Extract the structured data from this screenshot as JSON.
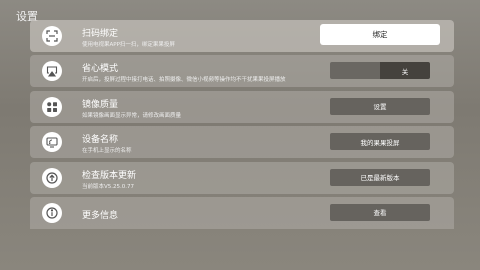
{
  "page": {
    "title": "设置"
  },
  "rows": [
    {
      "icon": "scan-icon",
      "title": "扫码绑定",
      "subtitle": "使用电视果APP扫一扫，绑定果果投屏",
      "action": "绑定"
    },
    {
      "icon": "airplay-icon",
      "title": "省心模式",
      "subtitle": "开启后，投屏过程中接打电话、拍照摄像、微信小视频等操作均不干扰果果投屏播放",
      "action": "关",
      "toggle_state": "off"
    },
    {
      "icon": "grid-icon",
      "title": "镜像质量",
      "subtitle": "如果镜像画面显示异常，请修改画面质量",
      "action": "设置"
    },
    {
      "icon": "cast-icon",
      "title": "设备名称",
      "subtitle": "在手机上显示的名称",
      "action": "我的果果投屏"
    },
    {
      "icon": "arrow-up-icon",
      "title": "检查版本更新",
      "subtitle": "当前版本V5.25.0.77",
      "action": "已是最新版本"
    },
    {
      "icon": "info-icon",
      "title": "更多信息",
      "subtitle": "",
      "action": "查看"
    }
  ],
  "colors": {
    "accent_button_bg": "#ffffff",
    "button_bg": "#66635e",
    "toggle_knob_bg": "#45423d"
  }
}
